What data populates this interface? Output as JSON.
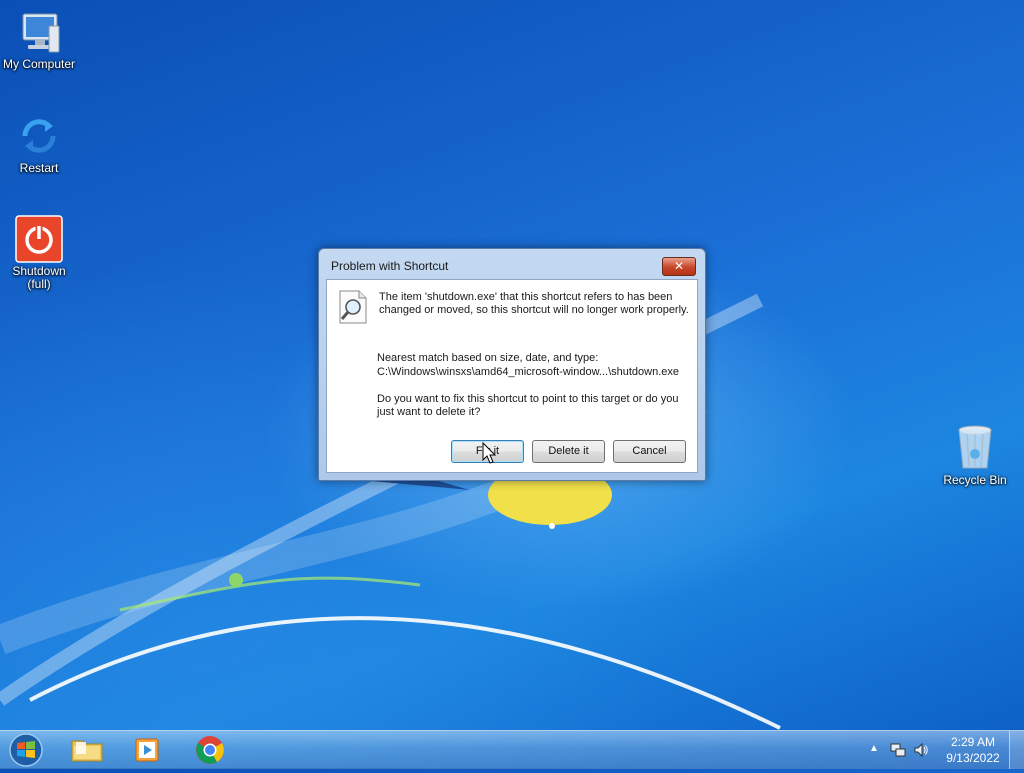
{
  "desktop": {
    "icons": [
      {
        "label": "My Computer"
      },
      {
        "label": "Restart"
      },
      {
        "label": "Shutdown\n(full)"
      },
      {
        "label": "Recycle Bin"
      }
    ]
  },
  "dialog": {
    "title": "Problem with Shortcut",
    "close_label": "✕",
    "message": "The item 'shutdown.exe' that this shortcut refers to has been changed or moved, so this shortcut will no longer work properly.",
    "nearest_label": "Nearest match based on size, date, and type:",
    "nearest_path": "C:\\Windows\\winsxs\\amd64_microsoft-window...\\shutdown.exe",
    "question": "Do you want to fix this shortcut to point to this target or do you just want to delete it?",
    "buttons": {
      "fix": "Fix it",
      "delete": "Delete it",
      "cancel": "Cancel"
    }
  },
  "taskbar": {
    "apps": [
      "windows-explorer-icon",
      "media-player-icon",
      "chrome-icon"
    ],
    "clock": {
      "time": "2:29 AM",
      "date": "9/13/2022"
    },
    "tray_icons": [
      "show-hidden-icons-arrow",
      "network-icon",
      "volume-icon"
    ]
  },
  "colors": {
    "desktop_blue": "#1b6fd6",
    "dialog_frame": "#c4d9f1",
    "close_red": "#c8462a"
  }
}
